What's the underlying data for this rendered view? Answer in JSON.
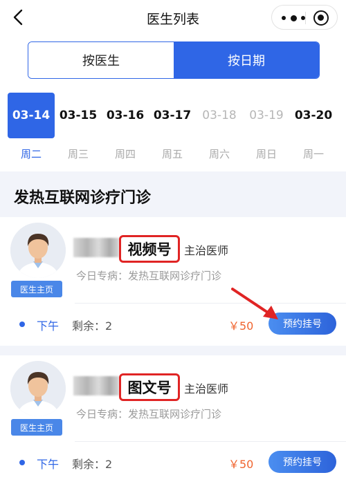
{
  "nav": {
    "title": "医生列表"
  },
  "tabs": [
    {
      "label": "按医生",
      "active": false
    },
    {
      "label": "按日期",
      "active": true
    }
  ],
  "dates": [
    {
      "date": "03-14",
      "weekday": "周二",
      "state": "selected"
    },
    {
      "date": "03-15",
      "weekday": "周三",
      "state": "available"
    },
    {
      "date": "03-16",
      "weekday": "周四",
      "state": "available"
    },
    {
      "date": "03-17",
      "weekday": "周五",
      "state": "available"
    },
    {
      "date": "03-18",
      "weekday": "周六",
      "state": "disabled"
    },
    {
      "date": "03-19",
      "weekday": "周日",
      "state": "disabled"
    },
    {
      "date": "03-20",
      "weekday": "周一",
      "state": "available"
    }
  ],
  "section": {
    "title": "发热互联网诊疗门诊"
  },
  "doctors": [
    {
      "highlight_label": "视频号",
      "title": "主治医师",
      "specialty": "今日专病：发热互联网诊疗门诊",
      "home_label": "医生主页",
      "period": "下午",
      "remaining": "剩余：2",
      "price": "￥50",
      "book_label": "预约挂号"
    },
    {
      "highlight_label": "图文号",
      "title": "主治医师",
      "specialty": "今日专病：发热互联网诊疗门诊",
      "home_label": "医生主页",
      "period": "下午",
      "remaining": "剩余：2",
      "price": "￥50",
      "book_label": "预约挂号"
    }
  ],
  "colors": {
    "primary": "#2f66e6",
    "price": "#f0642f",
    "highlight_box": "#e02424",
    "arrow": "#e02424"
  },
  "icons": {
    "back": "chevron-left-icon",
    "more": "more-dots-icon",
    "close": "target-circle-icon",
    "avatar": "doctor-avatar-icon",
    "annotation": "red-arrow-icon"
  }
}
